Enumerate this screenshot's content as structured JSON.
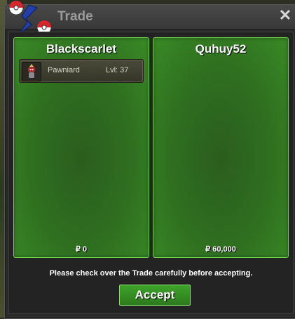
{
  "window": {
    "title": "Trade",
    "close_glyph": "✕"
  },
  "left_panel": {
    "trainer": "Blackscarlet",
    "items": [
      {
        "pokemon": "Pawniard",
        "level": "Lvl: 37",
        "sprite_icon": "pawniard-sprite-icon"
      }
    ],
    "money": "₽ 0"
  },
  "right_panel": {
    "trainer": "Quhuy52",
    "money": "₽ 60,000"
  },
  "footer": {
    "notice": "Please check over the Trade carefully before accepting.",
    "accept_label": "Accept"
  },
  "colors": {
    "panel_green": "#2f7020",
    "panel_border": "#6ed14a",
    "accent_red": "#d8262c",
    "accent_blue": "#2440a8"
  }
}
